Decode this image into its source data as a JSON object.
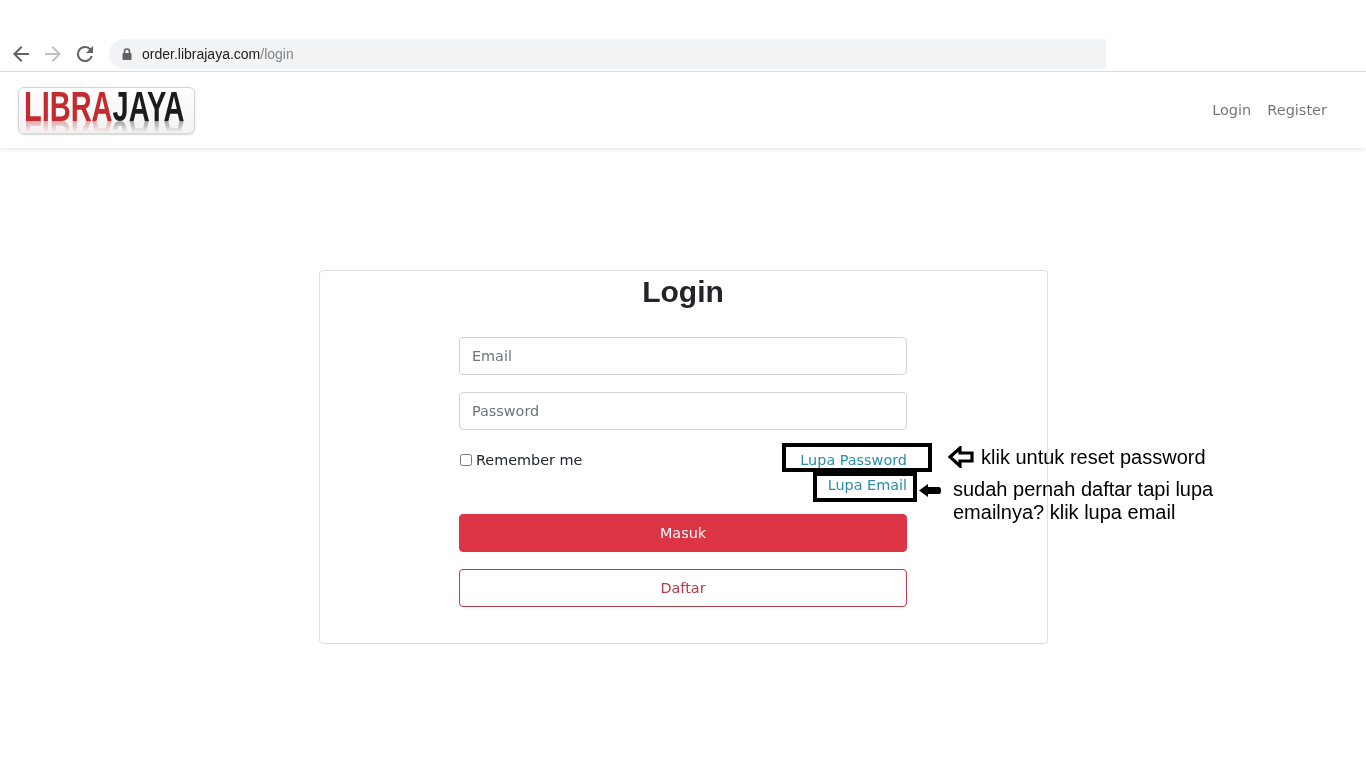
{
  "browser": {
    "buttons": [
      {
        "kind": "back",
        "disabled": false
      },
      {
        "kind": "forward",
        "disabled": true
      },
      {
        "kind": "reload",
        "disabled": false
      }
    ],
    "url": {
      "host": "order.librajaya.com",
      "path": "/login"
    }
  },
  "navbar": {
    "logo": {
      "parts": [
        "LIBRA",
        "JAYA"
      ]
    },
    "links": [
      {
        "label": "Login"
      },
      {
        "label": "Register"
      }
    ]
  },
  "login_card": {
    "title": "Login",
    "fields": [
      {
        "placeholder": "Email"
      },
      {
        "placeholder": "Password"
      }
    ],
    "remember": {
      "label": "Remember me",
      "checked": false
    },
    "links": [
      {
        "label": "Lupa Password",
        "highlighted": true,
        "annotation": {
          "kind": "outline",
          "text": "klik untuk reset password"
        }
      },
      {
        "label": "Lupa Email",
        "highlighted": true,
        "annotation": {
          "kind": "solid",
          "text": "sudah pernah daftar tapi lupa emailnya? klik lupa email"
        }
      }
    ],
    "buttons": [
      {
        "label": "Masuk",
        "kind": "primary"
      },
      {
        "label": "Daftar",
        "kind": "outline"
      }
    ]
  }
}
